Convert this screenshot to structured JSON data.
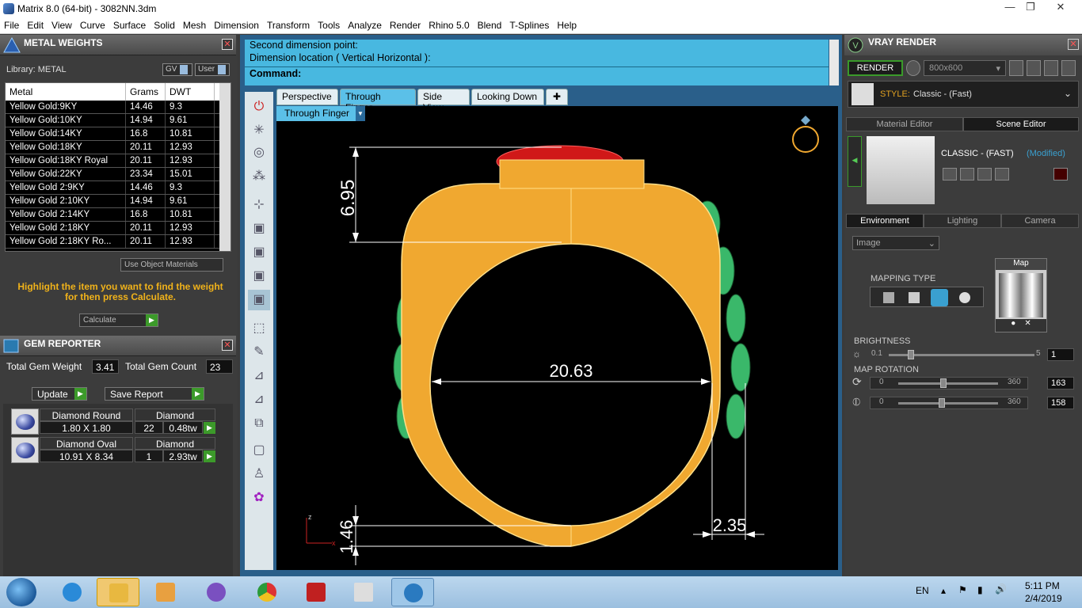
{
  "window": {
    "title": "Matrix 8.0 (64-bit) - 3082NN.3dm",
    "minimize": "—",
    "maximize": "❐",
    "close": "✕"
  },
  "menu": [
    "File",
    "Edit",
    "View",
    "Curve",
    "Surface",
    "Solid",
    "Mesh",
    "Dimension",
    "Transform",
    "Tools",
    "Analyze",
    "Render",
    "Rhino 5.0",
    "Blend",
    "T-Splines",
    "Help"
  ],
  "metal_weights": {
    "title": "METAL WEIGHTS",
    "library": "Library: METAL",
    "gv": "GV",
    "user": "User",
    "columns": [
      "Metal",
      "Grams",
      "DWT"
    ],
    "rows": [
      [
        "Yellow Gold:9KY",
        "14.46",
        "9.3"
      ],
      [
        "Yellow Gold:10KY",
        "14.94",
        "9.61"
      ],
      [
        "Yellow Gold:14KY",
        "16.8",
        "10.81"
      ],
      [
        "Yellow Gold:18KY",
        "20.11",
        "12.93"
      ],
      [
        "Yellow Gold:18KY Royal",
        "20.11",
        "12.93"
      ],
      [
        "Yellow Gold:22KY",
        "23.34",
        "15.01"
      ],
      [
        "Yellow Gold 2:9KY",
        "14.46",
        "9.3"
      ],
      [
        "Yellow Gold 2:10KY",
        "14.94",
        "9.61"
      ],
      [
        "Yellow Gold 2:14KY",
        "16.8",
        "10.81"
      ],
      [
        "Yellow Gold 2:18KY",
        "20.11",
        "12.93"
      ],
      [
        "Yellow Gold 2:18KY Ro...",
        "20.11",
        "12.93"
      ]
    ],
    "use_object_materials": "Use Object Materials",
    "hint": "Highlight the item you want to find the weight for then press Calculate.",
    "calculate": "Calculate"
  },
  "gem_reporter": {
    "title": "GEM REPORTER",
    "total_weight_label": "Total Gem Weight",
    "total_weight": "3.41",
    "total_count_label": "Total Gem Count",
    "total_count": "23",
    "update": "Update",
    "save_report": "Save Report",
    "gems": [
      {
        "name": "Diamond Round",
        "material": "Diamond",
        "size": "1.80 X 1.80",
        "count": "22",
        "weight": "0.48tw"
      },
      {
        "name": "Diamond Oval",
        "material": "Diamond",
        "size": "10.91 X 8.34",
        "count": "1",
        "weight": "2.93tw"
      }
    ]
  },
  "command": {
    "line1": "Second dimension point:",
    "line2": "Dimension location ( Vertical  Horizontal ):",
    "prompt": "Command:"
  },
  "viewport_tabs": [
    "Perspective",
    "Through Finger",
    "Side View",
    "Looking Down",
    "✚"
  ],
  "active_tab": "Through Finger",
  "viewport_label": "Through Finger",
  "dimensions": {
    "top_height": "6.95",
    "inner_diameter": "20.63",
    "bottom_thickness": "1.46",
    "side_thickness": "2.35"
  },
  "axis": {
    "z": "z",
    "x": "x"
  },
  "vray": {
    "title": "VRAY RENDER",
    "render": "RENDER",
    "resolution": "800x600",
    "style_label": "STYLE:",
    "style_value": "Classic - (Fast)",
    "tabs_top": [
      "Material Editor",
      "Scene Editor"
    ],
    "scene_name": "CLASSIC - (FAST)",
    "scene_state": "(Modified)",
    "tabs_env": [
      "Environment",
      "Lighting",
      "Camera"
    ],
    "env_source": "Image",
    "mapping_type": "MAPPING TYPE",
    "map": "Map",
    "brightness": {
      "label": "BRIGHTNESS",
      "min": "0.1",
      "max": "5",
      "value": "1",
      "level": 0.15
    },
    "map_rotation": {
      "label": "MAP ROTATION"
    },
    "rot1": {
      "min": "0",
      "max": "360",
      "value": "163",
      "level": 0.45
    },
    "rot2": {
      "min": "0",
      "max": "360",
      "value": "158",
      "level": 0.44
    }
  },
  "taskbar": {
    "lang": "EN",
    "time": "5:11 PM",
    "date": "2/4/2019"
  },
  "colors": {
    "gold": "#f0a830",
    "gold_line": "#ffe08a",
    "green_gem": "#3ab86a",
    "red_gem": "#d01818",
    "accent_blue": "#5bc0e8"
  }
}
